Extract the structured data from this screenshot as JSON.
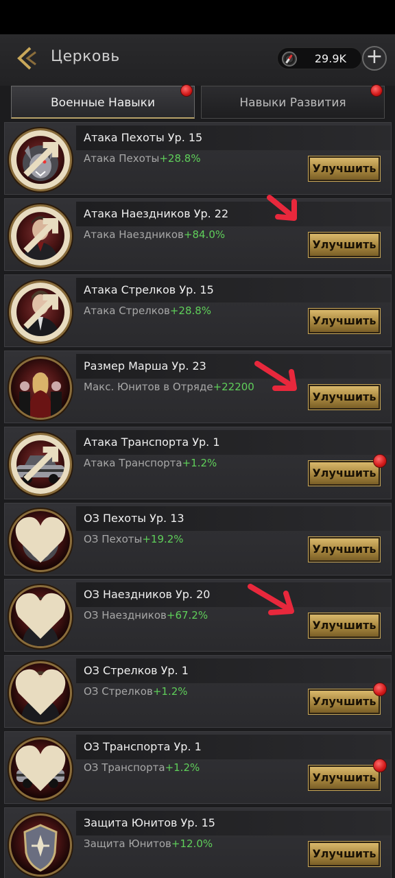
{
  "header": {
    "title": "Церковь",
    "currency_value": "29.9K"
  },
  "tabs": [
    {
      "label": "Военные Навыки",
      "active": true
    },
    {
      "label": "Навыки Развития",
      "active": false
    }
  ],
  "skills": [
    {
      "title": "Атака Пехоты Ур. 15",
      "stat": "Атака Пехоты",
      "bonus": "+28.8%",
      "button": "Улучшить",
      "portrait": "werewolf",
      "badge": "attack",
      "notify": false
    },
    {
      "title": "Атака Наездников Ур. 22",
      "stat": "Атака Наездников",
      "bonus": "+84.0%",
      "button": "Улучшить",
      "portrait": "man-jacket",
      "badge": "attack",
      "notify": false
    },
    {
      "title": "Атака Стрелков Ур. 15",
      "stat": "Атака Стрелков",
      "bonus": "+28.8%",
      "button": "Улучшить",
      "portrait": "man-suit",
      "badge": "attack",
      "notify": false
    },
    {
      "title": "Размер Марша Ур. 23",
      "stat": "Макс. Юнитов в Отряде",
      "bonus": "+22200",
      "button": "Улучшить",
      "portrait": "group",
      "badge": "none",
      "notify": false
    },
    {
      "title": "Атака Транспорта Ур. 1",
      "stat": "Атака Транспорта",
      "bonus": "+1.2%",
      "button": "Улучшить",
      "portrait": "car",
      "badge": "attack",
      "notify": true
    },
    {
      "title": "ОЗ Пехоты Ур. 13",
      "stat": "ОЗ Пехоты",
      "bonus": "+19.2%",
      "button": "Улучшить",
      "portrait": "werewolf",
      "badge": "heart",
      "notify": false
    },
    {
      "title": "ОЗ Наездников Ур. 20",
      "stat": "ОЗ Наездников",
      "bonus": "+67.2%",
      "button": "Улучшить",
      "portrait": "man-jacket",
      "badge": "heart",
      "notify": false
    },
    {
      "title": "ОЗ Стрелков Ур. 1",
      "stat": "ОЗ Стрелков",
      "bonus": "+1.2%",
      "button": "Улучшить",
      "portrait": "man-suit",
      "badge": "heart",
      "notify": true
    },
    {
      "title": "ОЗ Транспорта Ур. 1",
      "stat": "ОЗ Транспорта",
      "bonus": "+1.2%",
      "button": "Улучшить",
      "portrait": "car",
      "badge": "heart",
      "notify": true
    },
    {
      "title": "Защита Юнитов Ур. 15",
      "stat": "Защита Юнитов",
      "bonus": "+12.0%",
      "button": "Улучшить",
      "portrait": "shield",
      "badge": "none",
      "notify": false
    }
  ],
  "colors": {
    "bonus_green": "#5fcf5a",
    "button_gold": "#c9a85a",
    "notify_red": "#d01818",
    "annotation_red": "#e8283c"
  }
}
